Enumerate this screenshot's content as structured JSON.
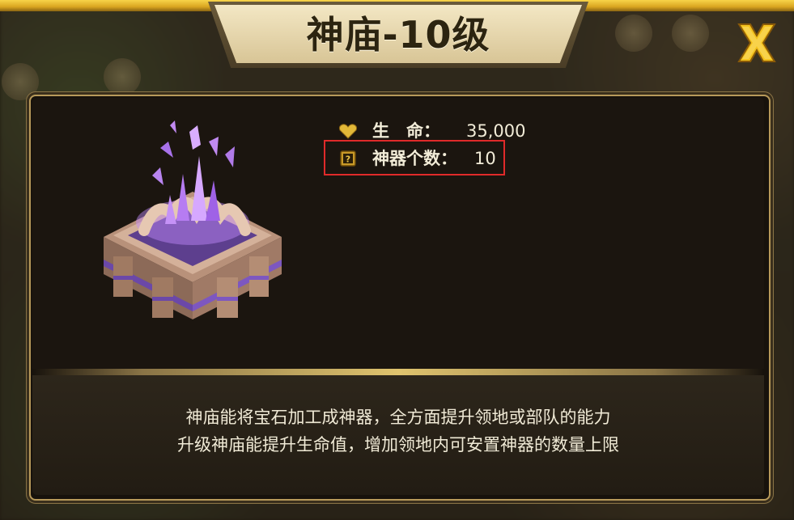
{
  "title": "神庙-10级",
  "stats": [
    {
      "icon": "heart-icon",
      "label": "生　命：",
      "value": "35,000"
    },
    {
      "icon": "question-box-icon",
      "label": "神器个数：",
      "value": "10"
    }
  ],
  "description": [
    "神庙能将宝石加工成神器，全方面提升领地或部队的能力",
    "升级神庙能提升生命值，增加领地内可安置神器的数量上限"
  ],
  "colors": {
    "gold": "#f7d44a",
    "panel": "#17120c",
    "highlight": "#e02a2a",
    "text": "#f2ecd8"
  }
}
